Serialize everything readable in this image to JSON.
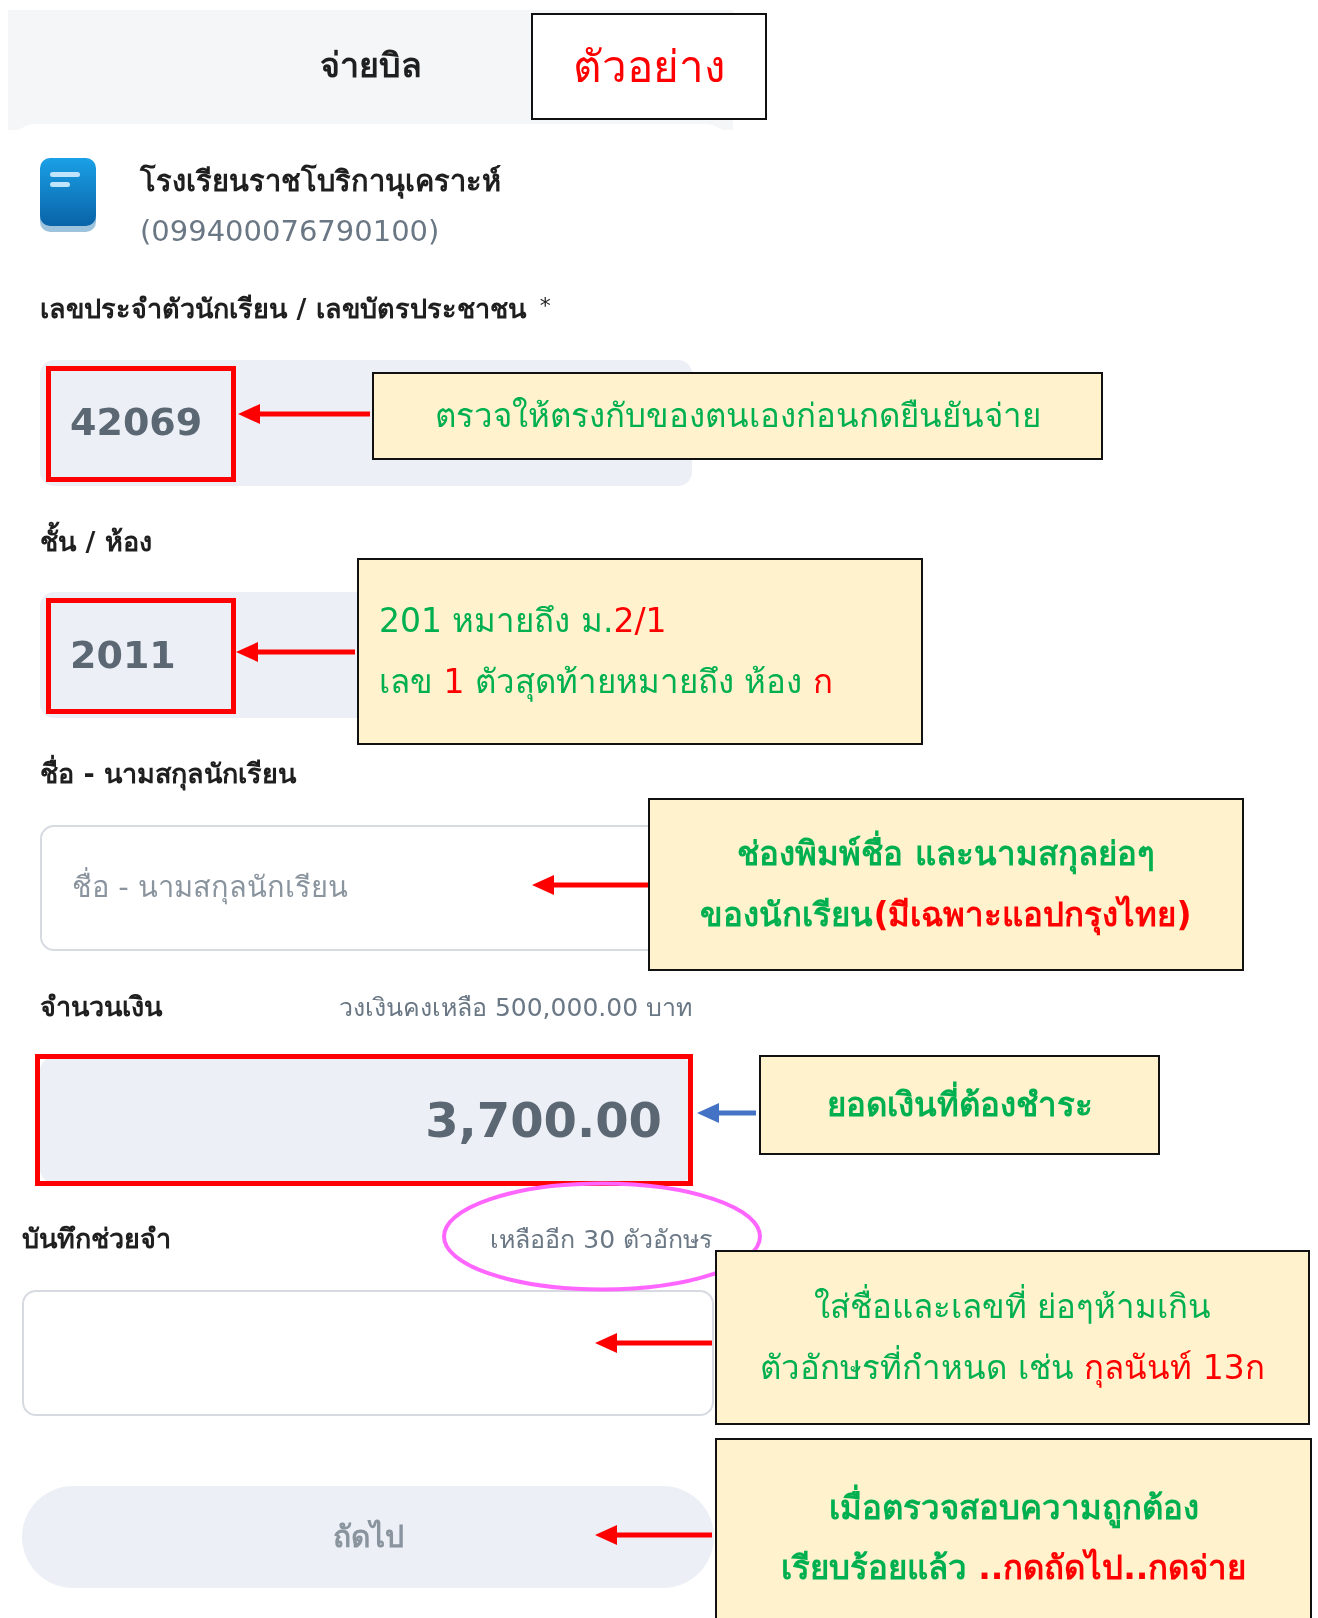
{
  "header": {
    "title": "จ่ายบิล"
  },
  "sample_stamp": "ตัวอย่าง",
  "biller": {
    "name": "โรงเรียนราชโบริกานุเคราะห์",
    "code": "(099400076790100)"
  },
  "fields": [
    {
      "kind": "filled",
      "label": "เลขประจำตัวนักเรียน / เลขบัตรประชาชน",
      "required_mark": "*",
      "value": "42069",
      "highlighted": true
    },
    {
      "kind": "filled",
      "label": "ชั้น / ห้อง",
      "value": "2011",
      "highlighted": true
    },
    {
      "kind": "input",
      "label": "ชื่อ - นามสกุลนักเรียน",
      "placeholder": "ชื่อ - นามสกุลนักเรียน"
    },
    {
      "kind": "amount",
      "label": "จำนวนเงิน",
      "hint": "วงเงินคงเหลือ 500,000.00 บาท",
      "value": "3,700.00",
      "highlighted": true
    },
    {
      "kind": "memo",
      "label": "บันทึกช่วยจำ",
      "hint": "เหลืออีก 30 ตัวอักษร",
      "circled": true
    }
  ],
  "next_button": {
    "label": "ถัดไป",
    "disabled": true
  },
  "annotations": [
    {
      "bold": false,
      "arrow": {
        "color": "#ff0000"
      },
      "lines": [
        [
          {
            "text": "ตรวจให้ตรงกับของตนเองก่อนกดยืนยันจ่าย",
            "color": "#00b050"
          }
        ]
      ]
    },
    {
      "bold": false,
      "arrow": {
        "color": "#ff0000"
      },
      "lines": [
        [
          {
            "text": "201 หมายถึง ม.",
            "color": "#00b050"
          },
          {
            "text": "2/1",
            "color": "#ff0000"
          }
        ],
        [
          {
            "text": "เลข ",
            "color": "#00b050"
          },
          {
            "text": "1",
            "color": "#ff0000"
          },
          {
            "text": " ตัวสุดท้ายหมายถึง ห้อง ",
            "color": "#00b050"
          },
          {
            "text": "ก",
            "color": "#ff0000"
          }
        ]
      ]
    },
    {
      "bold": true,
      "arrow": {
        "color": "#ff0000"
      },
      "lines": [
        [
          {
            "text": "ช่องพิมพ์ชื่อ และนามสกุลย่อๆ",
            "color": "#00b050"
          }
        ],
        [
          {
            "text": "ของนักเรียน",
            "color": "#00b050"
          },
          {
            "text": "(มีเฉพาะแอปกรุงไทย)",
            "color": "#ff0000"
          }
        ]
      ]
    },
    {
      "bold": true,
      "arrow": {
        "color": "#4472c4"
      },
      "lines": [
        [
          {
            "text": "ยอดเงินที่ต้องชำระ",
            "color": "#00b050"
          }
        ]
      ]
    },
    {
      "bold": false,
      "arrow": {
        "color": "#ff0000"
      },
      "lines": [
        [
          {
            "text": "ใส่ชื่อและเลขที่ ย่อๆห้ามเกิน",
            "color": "#00b050"
          }
        ],
        [
          {
            "text": "ตัวอักษรที่กำหนด เช่น ",
            "color": "#00b050"
          },
          {
            "text": "กุลนันท์ 13ก",
            "color": "#ff0000"
          }
        ]
      ]
    },
    {
      "bold": true,
      "arrow": {
        "color": "#ff0000"
      },
      "lines": [
        [
          {
            "text": "เมื่อตรวจสอบความถูกต้อง",
            "color": "#00b050"
          }
        ],
        [
          {
            "text": "เรียบร้อยแล้ว ",
            "color": "#00b050"
          },
          {
            "text": "..กดถัดไป..กดจ่าย",
            "color": "#ff0000"
          }
        ]
      ]
    }
  ]
}
